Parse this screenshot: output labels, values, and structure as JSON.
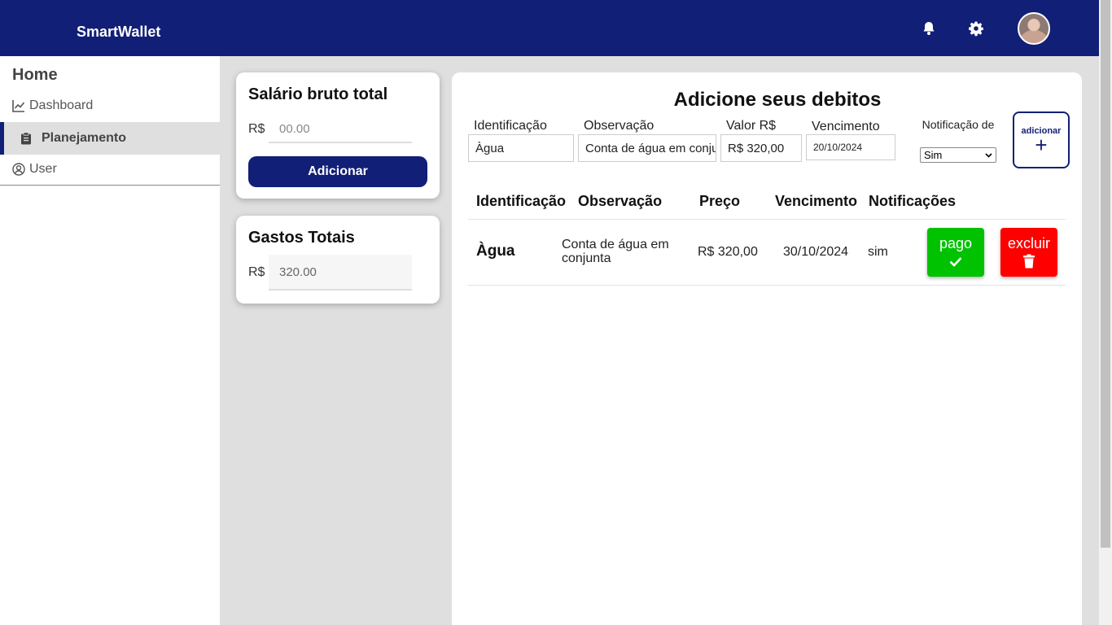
{
  "header": {
    "brand": "SmartWallet"
  },
  "sidebar": {
    "home": "Home",
    "items": [
      {
        "label": "Dashboard",
        "icon": "chart-line-icon"
      },
      {
        "label": "Planejamento",
        "icon": "clipboard-icon"
      },
      {
        "label": "User",
        "icon": "user-circle-icon"
      }
    ]
  },
  "salary_card": {
    "title": "Salário bruto total",
    "currency": "R$",
    "placeholder": "00.00",
    "button": "Adicionar"
  },
  "expenses_card": {
    "title": "Gastos Totais",
    "currency": "R$",
    "value": "320.00"
  },
  "form": {
    "title": "Adicione seus debitos",
    "identificacao_label": "Identificação",
    "identificacao_value": "Àgua",
    "observacao_label": "Observação",
    "observacao_value": "Conta de água em conjunta",
    "valor_label": "Valor R$",
    "valor_value": "R$ 320,00",
    "vencimento_label": "Vencimento",
    "vencimento_value": "20/10/2024",
    "notificacao_label": "Notificação de",
    "notificacao_value": "Sim",
    "add_label": "adicionar",
    "add_plus": "+"
  },
  "table": {
    "headers": [
      "Identificação",
      "Observação",
      "Preço",
      "Vencimento",
      "Notificações"
    ],
    "rows": [
      {
        "identificacao": "Àgua",
        "observacao": "Conta de água em conjunta",
        "preco": "R$ 320,00",
        "vencimento": "30/10/2024",
        "notificacao": "sim",
        "pago_label": "pago",
        "excluir_label": "excluir"
      }
    ]
  },
  "colors": {
    "primary": "#121f76",
    "paid": "#00c200",
    "delete": "#ff0000",
    "background": "#e0dfe0"
  }
}
